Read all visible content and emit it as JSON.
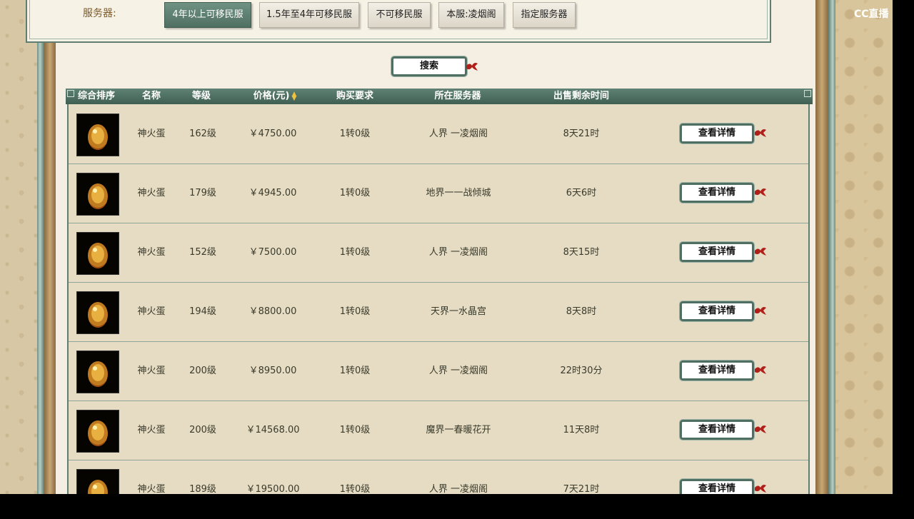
{
  "watermark": "CC直播",
  "filter": {
    "label": "服务器:",
    "options": [
      {
        "label": "4年以上可移民服",
        "active": true
      },
      {
        "label": "1.5年至4年可移民服",
        "active": false
      },
      {
        "label": "不可移民服",
        "active": false
      },
      {
        "label": "本服:凌烟阁",
        "active": false
      },
      {
        "label": "指定服务器",
        "active": false
      }
    ]
  },
  "search": {
    "label": "搜索"
  },
  "table": {
    "headers": {
      "rank": "综合排序",
      "name": "名称",
      "level": "等级",
      "price": "价格(元)",
      "requirement": "购买要求",
      "server": "所在服务器",
      "remaining": "出售剩余时间"
    },
    "detail_label": "查看详情",
    "rows": [
      {
        "name": "神火蛋",
        "level": "162级",
        "price": "￥4750.00",
        "requirement": "1转0级",
        "server": "人界 一凌烟阁",
        "remaining": "8天21时"
      },
      {
        "name": "神火蛋",
        "level": "179级",
        "price": "￥4945.00",
        "requirement": "1转0级",
        "server": "地界一一战倾城",
        "remaining": "6天6时"
      },
      {
        "name": "神火蛋",
        "level": "152级",
        "price": "￥7500.00",
        "requirement": "1转0级",
        "server": "人界 一凌烟阁",
        "remaining": "8天15时"
      },
      {
        "name": "神火蛋",
        "level": "194级",
        "price": "￥8800.00",
        "requirement": "1转0级",
        "server": "天界一水晶宫",
        "remaining": "8天8时"
      },
      {
        "name": "神火蛋",
        "level": "200级",
        "price": "￥8950.00",
        "requirement": "1转0级",
        "server": "人界 一凌烟阁",
        "remaining": "22时30分"
      },
      {
        "name": "神火蛋",
        "level": "200级",
        "price": "￥14568.00",
        "requirement": "1转0级",
        "server": "魔界一春暖花开",
        "remaining": "11天8时"
      },
      {
        "name": "神火蛋",
        "level": "189级",
        "price": "￥19500.00",
        "requirement": "1转0级",
        "server": "人界 一凌烟阁",
        "remaining": "7天21时"
      }
    ]
  },
  "colors": {
    "frame_green": "#4f6f62",
    "panel_bg": "#f4efe2",
    "row_bg": "#e6dcc4",
    "ribbon_red": "#b0201a"
  }
}
